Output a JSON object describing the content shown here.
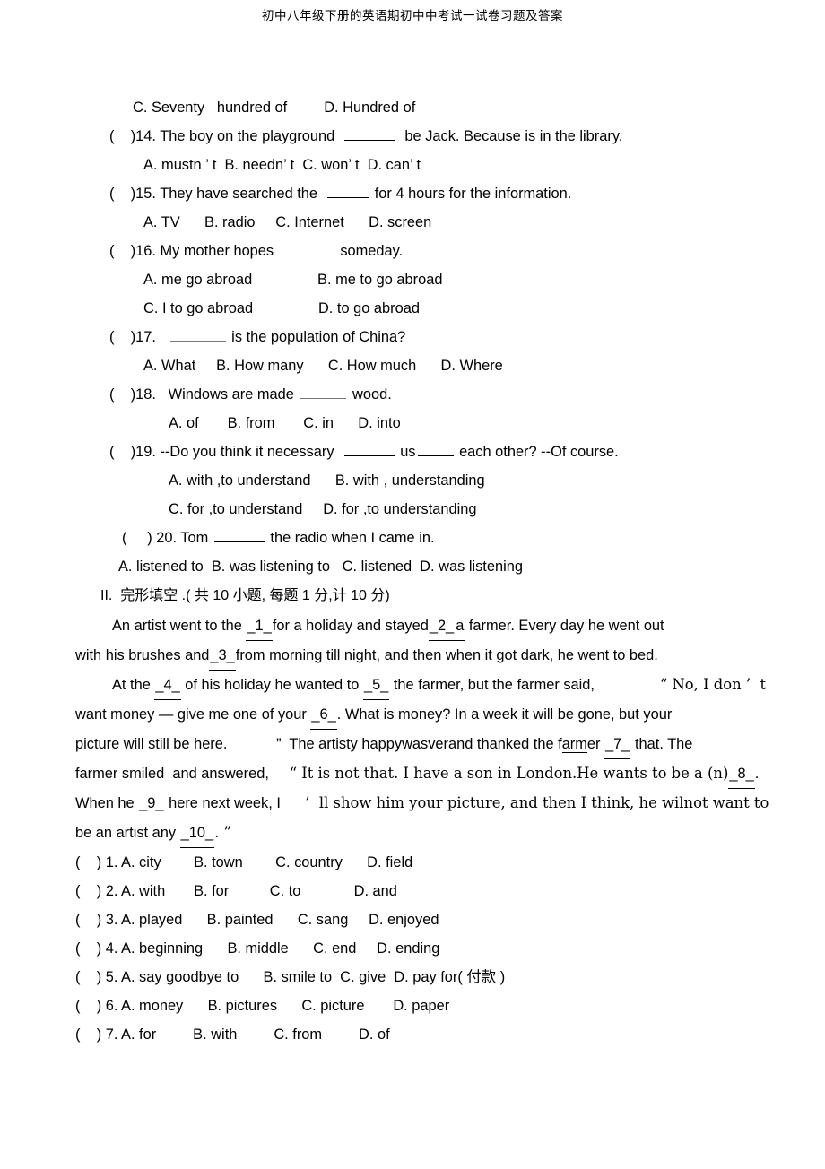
{
  "header": {
    "title": "初中八年级下册的英语期初中中考试一试卷习题及答案"
  },
  "top_orphan_line": {
    "option_c": "C. Seventy   hundred of",
    "option_d": "D. Hundred of"
  },
  "multiple_choice": {
    "paren": "(",
    "close_paren": ")",
    "questions": [
      {
        "number": "14",
        "stem_before": ")14. The boy on the playground",
        "stem_after": "be Jack. Because is in the library.",
        "options_line1": "A. mustn ’ t  B. needn’ t  C. won’ t  D. can’ t"
      },
      {
        "number": "15",
        "stem_before": ")15. They have searched the",
        "stem_after": "for 4 hours for the information.",
        "options_line1": "A. TV      B. radio     C. Internet      D. screen"
      },
      {
        "number": "16",
        "stem_before": ")16. My mother hopes",
        "stem_after": "someday.",
        "options_line1": "A. me go abroad                B. me to go abroad",
        "options_line2": "C. I to go abroad                D. to go abroad"
      },
      {
        "number": "17",
        "stem_before": ")17.",
        "stem_after": "is the population of China?",
        "options_line1": "A. What     B. How many      C. How much      D. Where"
      },
      {
        "number": "18",
        "stem_before": ")18.   Windows are made",
        "stem_after": "wood.",
        "options_line1": "A. of       B. from       C. in      D. into"
      },
      {
        "number": "19",
        "stem_before": ")19. --Do you think it necessary",
        "stem_mid": "us",
        "stem_after": "each other? --Of course.",
        "options_line1": "A. with ,to understand      B. with , understanding",
        "options_line2": "C. for ,to understand     D. for ,to understanding"
      },
      {
        "number": "20",
        "stem_before": ") 20. Tom",
        "stem_after": "the radio when I came in.",
        "options_line1": "A. listened to  B. was listening to   C. listened  D. was listening"
      }
    ]
  },
  "section_two": {
    "heading": "II.  完形填空 .( 共 10 小题, 每题 1 分,计 10 分)",
    "passage": {
      "p1_line1_a": "An artist went to the ",
      "p1_line1_g1": "_1_",
      "p1_line1_b": "for a holiday and stayed",
      "p1_line1_g2": "_2_",
      "p1_line1_c": "a",
      "p1_line1_d": " farmer. Every day he went out",
      "p1_line2_a": "with his brushes and",
      "p1_line2_g3": "_3_",
      "p1_line2_b": "from morning till night, and then when it got dark, he went to bed.",
      "p2_line1_a": "At the ",
      "p2_line1_g4": "_4_",
      "p2_line1_b": " of his holiday he wanted to ",
      "p2_line1_g5": "_5_",
      "p2_line1_c": " the farmer, but the farmer said,",
      "p2_line1_d": "“ No, I don ’  t",
      "p2_line2_a": "want money — give me one of your ",
      "p2_line2_g6": "_6_",
      "p2_line2_b": ". What is money? In a week it will be gone, but your",
      "p2_line3_a": "picture will still be here.",
      "p2_line3_b": "”  The artisty happywasverand thanked the f",
      "p2_line3_uline": "arm",
      "p2_line3_c": "er ",
      "p2_line3_g7": "_7_",
      "p2_line3_d": " that. The",
      "p2_line4_a": "farmer smiled  and answered,",
      "p2_line4_b": "“ It is not that. I have a son in London.He wants to be a (n)",
      "p2_line4_g8": "_8_",
      "p2_line4_c": ".",
      "p2_line5_a": "When he ",
      "p2_line5_g9": "_9_",
      "p2_line5_b": " here next week, I",
      "p2_line5_c": "’  ll show him your picture, and then I think, he wilnot want to",
      "p2_line6_a": "be an artist any ",
      "p2_line6_g10": "_10_",
      "p2_line6_b": ". ”"
    },
    "cloze_answers": [
      {
        "number": "1",
        "text": ") 1. A. city        B. town        C. country      D. field"
      },
      {
        "number": "2",
        "text": ") 2. A. with       B. for          C. to             D. and"
      },
      {
        "number": "3",
        "text": ") 3. A. played      B. painted      C. sang     D. enjoyed"
      },
      {
        "number": "4",
        "text": ") 4. A. beginning      B. middle      C. end     D. ending"
      },
      {
        "number": "5",
        "text": ") 5. A. say goodbye to      B. smile to  C. give  D. pay for( 付款 )"
      },
      {
        "number": "6",
        "text": ") 6. A. money      B. pictures      C. picture       D. paper"
      },
      {
        "number": "7",
        "text": ") 7. A. for         B. with         C. from         D. of"
      }
    ]
  }
}
